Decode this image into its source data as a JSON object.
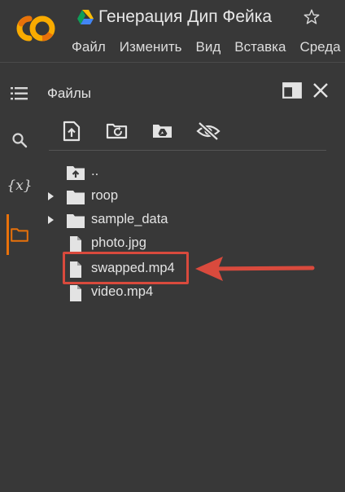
{
  "header": {
    "logo_text": "CO",
    "title": "Генерация Дип Фейка",
    "menu": [
      "Файл",
      "Изменить",
      "Вид",
      "Вставка",
      "Среда"
    ]
  },
  "rail": {
    "items": [
      {
        "name": "table-of-contents-icon"
      },
      {
        "name": "search-icon"
      },
      {
        "name": "variables-icon",
        "label": "{x}"
      },
      {
        "name": "files-icon",
        "active": true
      }
    ]
  },
  "files_panel": {
    "title": "Файлы",
    "toolbar": [
      "upload-file-icon",
      "refresh-folder-icon",
      "mount-drive-icon",
      "hide-hidden-files-icon"
    ],
    "tree": [
      {
        "label": "..",
        "type": "parent-folder"
      },
      {
        "label": "roop",
        "type": "folder",
        "expandable": true
      },
      {
        "label": "sample_data",
        "type": "folder",
        "expandable": true
      },
      {
        "label": "photo.jpg",
        "type": "file"
      },
      {
        "label": "swapped.mp4",
        "type": "file",
        "highlighted": true
      },
      {
        "label": "video.mp4",
        "type": "file"
      }
    ]
  },
  "colors": {
    "background": "#383838",
    "accent": "#e8710a",
    "highlight": "#d94a3d",
    "text": "#e3e3e3"
  }
}
